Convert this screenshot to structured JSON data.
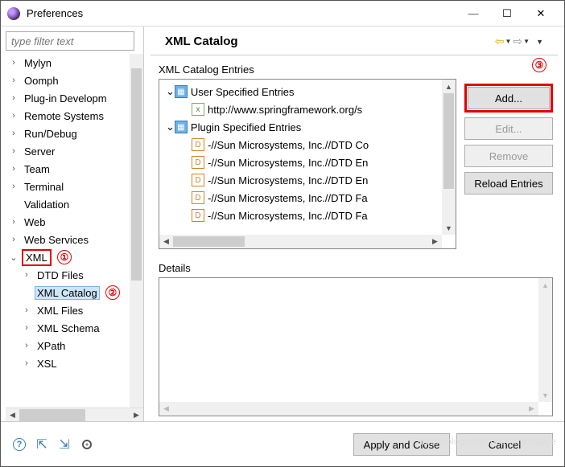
{
  "window": {
    "title": "Preferences"
  },
  "filter": {
    "placeholder": "type filter text"
  },
  "tree": {
    "items": [
      {
        "label": "Mylyn",
        "exp": ">"
      },
      {
        "label": "Oomph",
        "exp": ">"
      },
      {
        "label": "Plug-in Developm",
        "exp": ">"
      },
      {
        "label": "Remote Systems",
        "exp": ">"
      },
      {
        "label": "Run/Debug",
        "exp": ">"
      },
      {
        "label": "Server",
        "exp": ">"
      },
      {
        "label": "Team",
        "exp": ">"
      },
      {
        "label": "Terminal",
        "exp": ">"
      },
      {
        "label": "Validation",
        "exp": ""
      },
      {
        "label": "Web",
        "exp": ">"
      },
      {
        "label": "Web Services",
        "exp": ">"
      }
    ],
    "xml": {
      "label": "XML",
      "children": [
        {
          "label": "DTD Files",
          "exp": ">"
        },
        {
          "label": "XML Catalog",
          "exp": "",
          "selected": true
        },
        {
          "label": "XML Files",
          "exp": ">"
        },
        {
          "label": "XML Schema",
          "exp": ">"
        },
        {
          "label": "XPath",
          "exp": ">"
        },
        {
          "label": "XSL",
          "exp": ">"
        }
      ]
    }
  },
  "annotations": {
    "a1": "①",
    "a2": "②",
    "a3": "③"
  },
  "main": {
    "heading": "XML Catalog",
    "entries_label": "XML Catalog Entries",
    "details_label": "Details",
    "entries": {
      "user": {
        "label": "User Specified Entries",
        "items": [
          {
            "icon": "xml",
            "text": "http://www.springframework.org/s"
          }
        ]
      },
      "plugin": {
        "label": "Plugin Specified Entries",
        "items": [
          {
            "icon": "dtd",
            "text": "-//Sun Microsystems, Inc.//DTD Co"
          },
          {
            "icon": "dtd",
            "text": "-//Sun Microsystems, Inc.//DTD En"
          },
          {
            "icon": "dtd",
            "text": "-//Sun Microsystems, Inc.//DTD En"
          },
          {
            "icon": "dtd",
            "text": "-//Sun Microsystems, Inc.//DTD Fa"
          },
          {
            "icon": "dtd",
            "text": "-//Sun Microsystems, Inc.//DTD Fa"
          }
        ]
      }
    },
    "buttons": {
      "add": "Add...",
      "edit": "Edit...",
      "remove": "Remove",
      "reload": "Reload Entries"
    }
  },
  "footer": {
    "apply": "Apply and Close",
    "cancel": "Cancel"
  },
  "watermark": "https://blog.csdn.net/manongajie"
}
